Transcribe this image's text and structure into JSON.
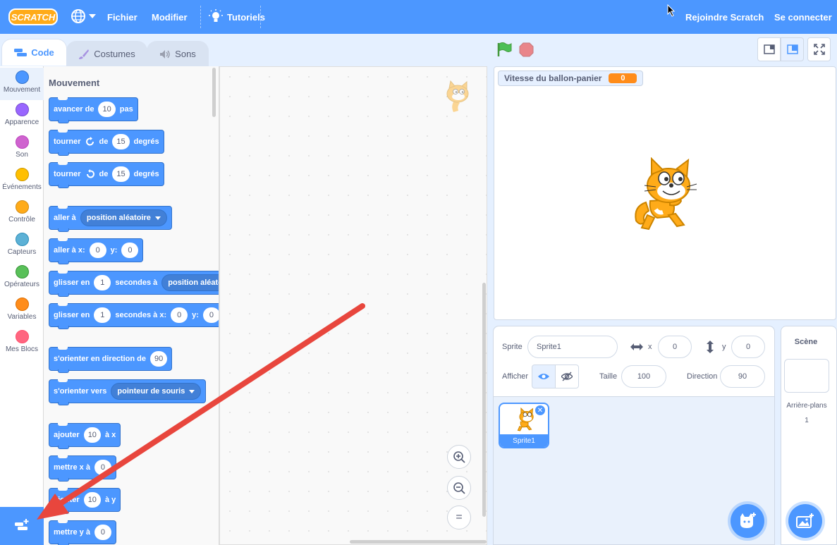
{
  "menu": {
    "logo_text": "SCRATCH",
    "file": "Fichier",
    "edit": "Modifier",
    "tutorials": "Tutoriels",
    "join": "Rejoindre Scratch",
    "signin": "Se connecter"
  },
  "tabs": {
    "code": "Code",
    "costumes": "Costumes",
    "sounds": "Sons"
  },
  "categories": [
    {
      "label": "Mouvement",
      "color": "#4c97ff"
    },
    {
      "label": "Apparence",
      "color": "#9966ff"
    },
    {
      "label": "Son",
      "color": "#cf63cf"
    },
    {
      "label": "Événements",
      "color": "#ffbf00"
    },
    {
      "label": "Contrôle",
      "color": "#ffab19"
    },
    {
      "label": "Capteurs",
      "color": "#5cb1d6"
    },
    {
      "label": "Opérateurs",
      "color": "#59c059"
    },
    {
      "label": "Variables",
      "color": "#ff8c1a"
    },
    {
      "label": "Mes Blocs",
      "color": "#ff6680"
    }
  ],
  "palette": {
    "title": "Mouvement",
    "blocks": {
      "move": {
        "t1": "avancer de",
        "v1": "10",
        "t2": "pas"
      },
      "turn_right": {
        "t1": "tourner",
        "t2": "de",
        "v1": "15",
        "t3": "degrés"
      },
      "turn_left": {
        "t1": "tourner",
        "t2": "de",
        "v1": "15",
        "t3": "degrés"
      },
      "goto": {
        "t1": "aller à",
        "d1": "position aléatoire"
      },
      "goto_xy": {
        "t1": "aller à x:",
        "v1": "0",
        "t2": "y:",
        "v2": "0"
      },
      "glide_to": {
        "t1": "glisser en",
        "v1": "1",
        "t2": "secondes à",
        "d1": "position aléatoire"
      },
      "glide_xy": {
        "t1": "glisser en",
        "v1": "1",
        "t2": "secondes à x:",
        "v2": "0",
        "t3": "y:",
        "v3": "0"
      },
      "point_dir": {
        "t1": "s'orienter en direction de",
        "v1": "90"
      },
      "point_towards": {
        "t1": "s'orienter vers",
        "d1": "pointeur de souris"
      },
      "change_x": {
        "t1": "ajouter",
        "v1": "10",
        "t2": "à x"
      },
      "set_x": {
        "t1": "mettre x à",
        "v1": "0"
      },
      "change_y": {
        "t1": "ajouter",
        "v1": "10",
        "t2": "à y"
      },
      "set_y": {
        "t1": "mettre y à",
        "v1": "0"
      }
    }
  },
  "zoom": {
    "reset": "="
  },
  "stage": {
    "monitor_label": "Vitesse du ballon-panier",
    "monitor_value": "0"
  },
  "sprite_info": {
    "sprite_label": "Sprite",
    "sprite_name": "Sprite1",
    "x_label": "x",
    "x_value": "0",
    "y_label": "y",
    "y_value": "0",
    "show_label": "Afficher",
    "size_label": "Taille",
    "size_value": "100",
    "direction_label": "Direction",
    "direction_value": "90"
  },
  "sprites": [
    {
      "name": "Sprite1",
      "selected": true
    }
  ],
  "scene": {
    "title": "Scène",
    "backdrops_label": "Arrière-plans",
    "backdrops_count": "1"
  },
  "colors": {
    "accent": "#4c97ff",
    "motion": "#4c97ff",
    "monitor": "#ff8c1a",
    "arrow": "#e8463d"
  }
}
